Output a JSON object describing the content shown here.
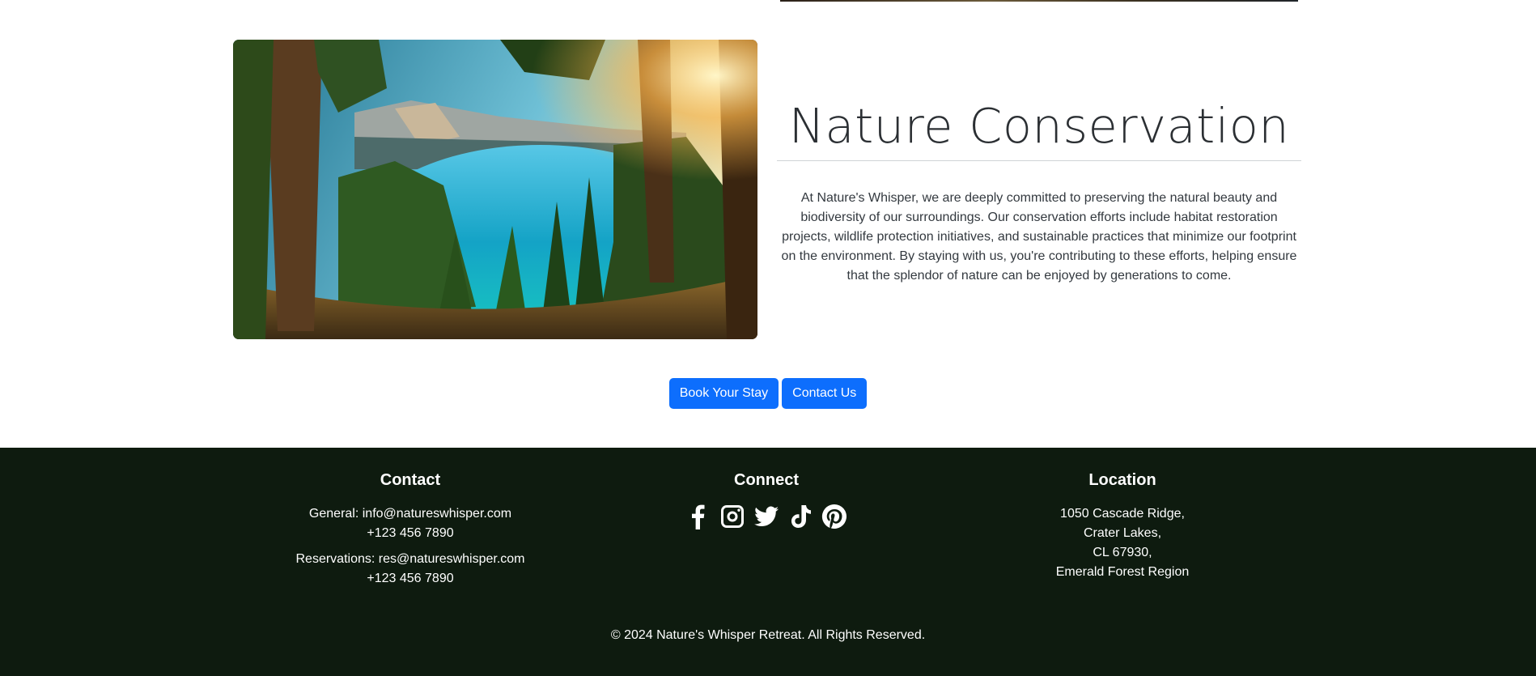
{
  "hero": {
    "title": "Nature Conservation",
    "body": "At Nature's Whisper, we are deeply committed to preserving the natural beauty and biodiversity of our surroundings. Our conservation efforts include habitat restoration projects, wildlife protection initiatives, and sustainable practices that minimize our footprint on the environment. By staying with us, you're contributing to these efforts, helping ensure that the splendor of nature can be enjoyed by generations to come."
  },
  "cta": {
    "book_label": "Book Your Stay",
    "contact_label": "Contact Us"
  },
  "footer": {
    "contact": {
      "heading": "Contact",
      "general_line": "General: info@natureswhisper.com",
      "general_phone": "+123 456 7890",
      "reservations_line": "Reservations: res@natureswhisper.com",
      "reservations_phone": "+123 456 7890"
    },
    "connect": {
      "heading": "Connect",
      "icons": [
        "facebook-icon",
        "instagram-icon",
        "twitter-icon",
        "tiktok-icon",
        "pinterest-icon"
      ]
    },
    "location": {
      "heading": "Location",
      "line1": "1050 Cascade Ridge,",
      "line2": "Crater Lakes,",
      "line3": "CL 67930,",
      "line4": "Emerald Forest Region"
    },
    "copyright": "© 2024 Nature's Whisper Retreat. All Rights Reserved."
  },
  "colors": {
    "primary_button": "#0d6efd",
    "footer_bg": "#0e1b0f"
  }
}
